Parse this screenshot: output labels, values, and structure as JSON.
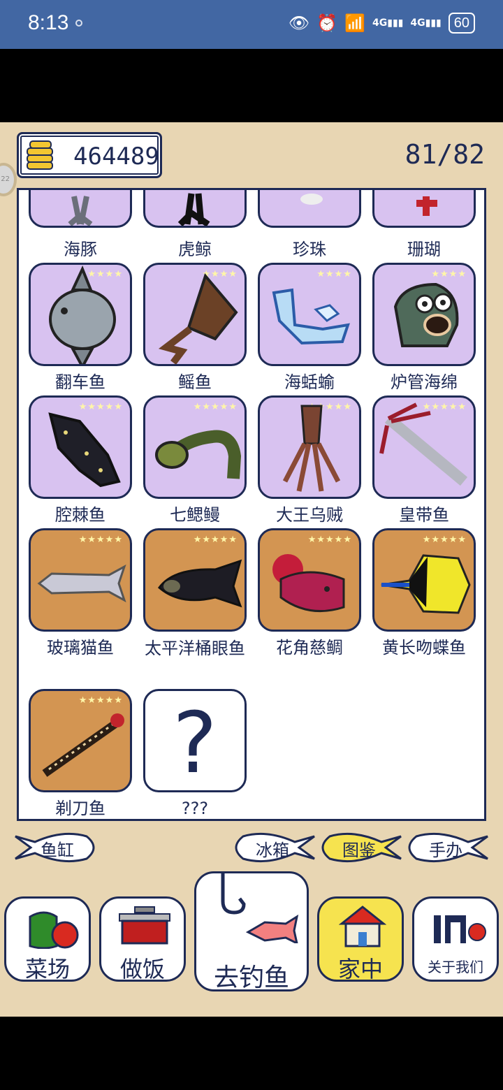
{
  "status": {
    "time": "8:13",
    "battery": "60"
  },
  "header": {
    "coins": "464489",
    "collection_count": "81/82"
  },
  "cards": [
    {
      "name": "海豚",
      "stars": "",
      "tier": "purple"
    },
    {
      "name": "虎鲸",
      "stars": "",
      "tier": "purple"
    },
    {
      "name": "珍珠",
      "stars": "",
      "tier": "purple"
    },
    {
      "name": "珊瑚",
      "stars": "",
      "tier": "purple"
    },
    {
      "name": "翻车鱼",
      "stars": "★★★★",
      "tier": "purple"
    },
    {
      "name": "鳐鱼",
      "stars": "★★★★",
      "tier": "purple"
    },
    {
      "name": "海蛞蝓",
      "stars": "★★★★",
      "tier": "purple"
    },
    {
      "name": "炉管海绵",
      "stars": "★★★★",
      "tier": "purple"
    },
    {
      "name": "腔棘鱼",
      "stars": "★★★★★",
      "tier": "purple"
    },
    {
      "name": "七鳃鳗",
      "stars": "★★★★★",
      "tier": "purple"
    },
    {
      "name": "大王乌贼",
      "stars": "★★★★★",
      "tier": "purple"
    },
    {
      "name": "皇带鱼",
      "stars": "★★★★★",
      "tier": "purple"
    },
    {
      "name": "玻璃猫鱼",
      "stars": "★★★★★",
      "tier": "gold"
    },
    {
      "name": "太平洋桶眼鱼",
      "stars": "★★★★★",
      "tier": "gold"
    },
    {
      "name": "花角慈鲷",
      "stars": "★★★★★",
      "tier": "gold"
    },
    {
      "name": "黄长吻蝶鱼",
      "stars": "★★★★★",
      "tier": "gold"
    },
    {
      "name": "剃刀鱼",
      "stars": "★★★★★",
      "tier": "gold"
    },
    {
      "name": "???",
      "stars": "",
      "tier": "unknown",
      "symbol": "?"
    }
  ],
  "subtabs": {
    "tank": "鱼缸",
    "fridge": "冰箱",
    "atlas": "图鉴",
    "figure": "手办"
  },
  "nav": {
    "market": "菜场",
    "cook": "做饭",
    "fish": "去钓鱼",
    "home": "家中",
    "about": "关于我们"
  }
}
